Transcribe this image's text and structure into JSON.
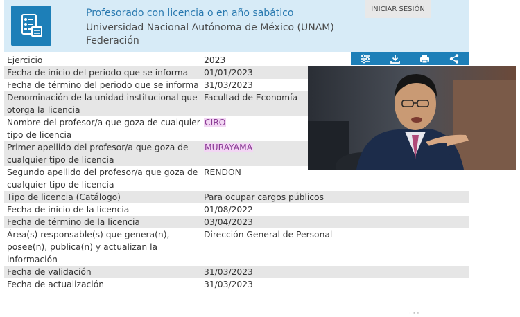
{
  "header": {
    "title": "Profesorado con licencia o en año sabático",
    "subtitle1": "Universidad Nacional Autónoma de México (UNAM)",
    "subtitle2": "Federación",
    "login_label": "INICIAR SESIÓN"
  },
  "toolbar": {
    "icons": [
      "filter-icon",
      "download-icon",
      "print-icon",
      "share-icon"
    ]
  },
  "rows": [
    {
      "label": "Ejercicio",
      "value": "2023"
    },
    {
      "label": "Fecha de inicio del periodo que se informa",
      "value": "01/01/2023"
    },
    {
      "label": "Fecha de término del periodo que se informa",
      "value": "31/03/2023"
    },
    {
      "label": "Denominación de la unidad institucional que otorga la licencia",
      "value": "Facultad de Economía"
    },
    {
      "label": "Nombre del profesor/a que goza de cualquier tipo de licencia",
      "value": "CIRO"
    },
    {
      "label": "Primer apellido del profesor/a que goza de cualquier tipo de licencia",
      "value": "MURAYAMA"
    },
    {
      "label": "Segundo apellido del profesor/a que goza de cualquier tipo de licencia",
      "value": "RENDON"
    },
    {
      "label": "Tipo de licencia (Catálogo)",
      "value": "Para ocupar cargos públicos"
    },
    {
      "label": "Fecha de inicio de la licencia",
      "value": "01/08/2022"
    },
    {
      "label": "Fecha de término de la licencia",
      "value": "03/04/2023"
    },
    {
      "label": "Área(s) responsable(s) que genera(n), posee(n), publica(n) y actualizan la información",
      "value": "Dirección General de Personal"
    },
    {
      "label": "Fecha de validación",
      "value": "31/03/2023"
    },
    {
      "label": "Fecha de actualización",
      "value": "31/03/2023"
    }
  ],
  "colors": {
    "header_bg": "#d7ebf7",
    "accent": "#1d7fb8",
    "row_alt": "#e6e6e6",
    "highlight_bg": "#f2d6f3",
    "highlight_text": "#8a3a94"
  }
}
